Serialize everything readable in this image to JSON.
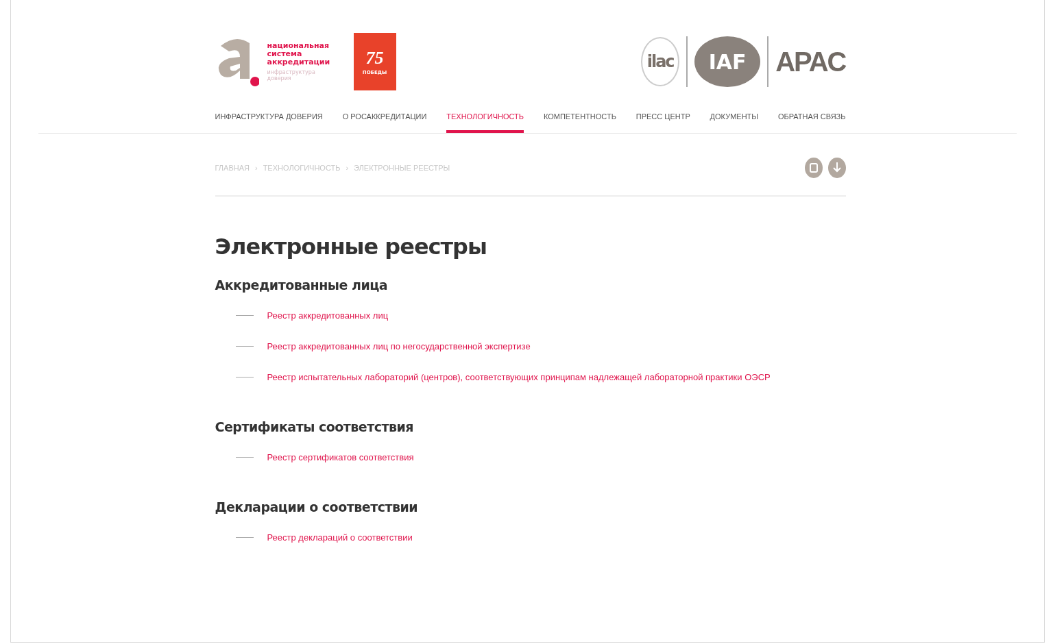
{
  "header": {
    "logo_title": "национальная система аккредитации",
    "logo_subtitle": "инфраструктура доверия",
    "badge_number": "75",
    "badge_text": "ПОБЕДЫ",
    "partners": [
      {
        "kind": "ilac",
        "label": "ilac"
      },
      {
        "kind": "iaf",
        "label": "IAF"
      },
      {
        "kind": "apac",
        "label": "APAC"
      }
    ]
  },
  "nav": [
    {
      "label": "ИНФРАСТРУКТУРА ДОВЕРИЯ",
      "selected": false
    },
    {
      "label": "О РОСАККРЕДИТАЦИИ",
      "selected": false
    },
    {
      "label": "ТЕХНОЛОГИЧНОСТЬ",
      "selected": true
    },
    {
      "label": "КОМПЕТЕНТНОСТЬ",
      "selected": false
    },
    {
      "label": "ПРЕСС ЦЕНТР",
      "selected": false
    },
    {
      "label": "ДОКУМЕНТЫ",
      "selected": false
    },
    {
      "label": "ОБРАТНАЯ СВЯЗЬ",
      "selected": false
    }
  ],
  "breadcrumbs": {
    "separator": "›",
    "items": [
      "ГЛАВНАЯ",
      "ТЕХНОЛОГИЧНОСТЬ",
      "ЭЛЕКТРОННЫЕ РЕЕСТРЫ"
    ]
  },
  "title": "Электронные реестры",
  "sections": [
    {
      "heading": "Аккредитованные лица",
      "links": [
        "Реестр аккредитованных лиц",
        "Реестр аккредитованных лиц по негосударственной экспертизе",
        "Реестр испытательных лабораторий (центров), соответствующих принципам надлежащей лабораторной практики ОЭСР"
      ]
    },
    {
      "heading": "Сертификаты соответствия",
      "links": [
        "Реестр сертификатов соответствия"
      ]
    },
    {
      "heading": "Декларации о соответствии",
      "links": [
        "Реестр деклараций о соответствии"
      ]
    }
  ]
}
